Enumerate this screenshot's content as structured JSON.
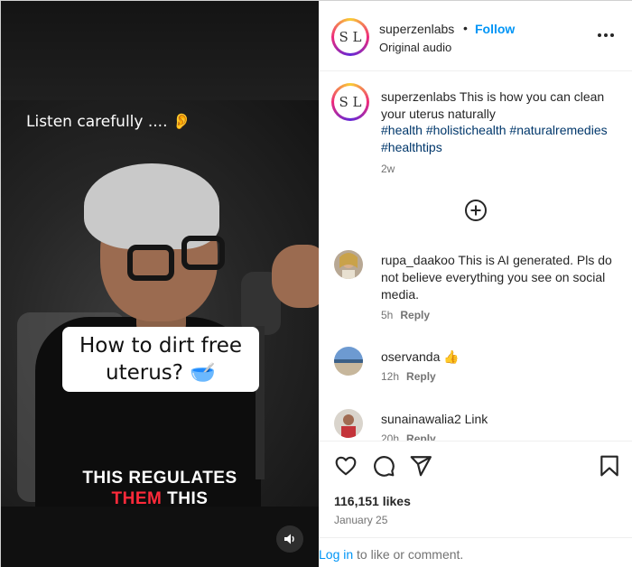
{
  "video": {
    "top_caption": "Listen carefully .... 👂",
    "question_caption_line1": "How to dirt free",
    "question_caption_line2": "uterus? 🥣",
    "subtitle_line1": "THIS REGULATES",
    "subtitle_line2_highlight": "THEM",
    "subtitle_line2_rest": " THIS",
    "audio_icon": "speaker-icon"
  },
  "header": {
    "avatar_text": "S L",
    "username": "superzenlabs",
    "separator": "•",
    "follow_label": "Follow",
    "subtitle": "Original audio",
    "more_icon": "more-options-icon"
  },
  "post_caption": {
    "username": "superzenlabs",
    "text": " This is how you can clean your uterus naturally",
    "hashtags": "#health #holistichealth #naturalremedies #healthtips",
    "time": "2w"
  },
  "load_more_icon": "plus-circle-icon",
  "comments": [
    {
      "username": "rupa_daakoo",
      "text": " This is AI generated. Pls do not believe everything you see on social media.",
      "time": "5h",
      "reply": "Reply"
    },
    {
      "username": "oservanda",
      "text": " 👍",
      "time": "12h",
      "reply": "Reply"
    },
    {
      "username": "sunainawalia2",
      "text": " Link",
      "time": "20h",
      "reply": "Reply"
    }
  ],
  "actions": {
    "like_icon": "heart-icon",
    "comment_icon": "comment-icon",
    "share_icon": "send-icon",
    "save_icon": "bookmark-icon",
    "likes": "116,151 likes",
    "date": "January 25"
  },
  "login": {
    "link": "Log in",
    "rest": " to like or comment."
  },
  "colors": {
    "link_blue": "#0095f6",
    "hashtag_blue": "#00376b",
    "muted": "#737373",
    "subtitle_red": "#ff2a3a"
  }
}
